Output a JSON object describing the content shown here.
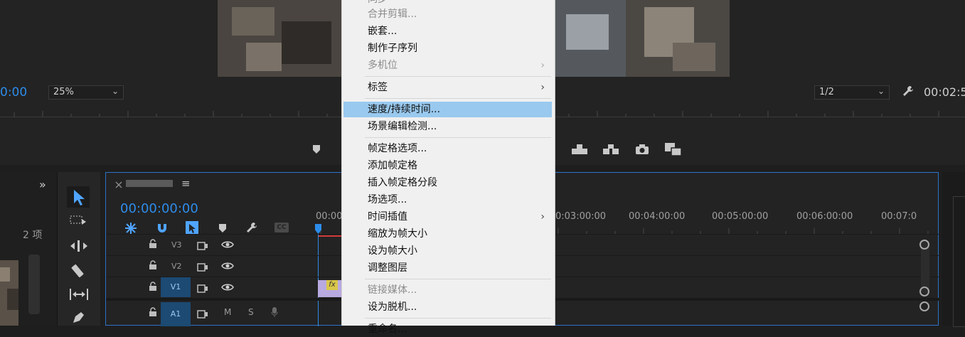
{
  "monitor": {
    "timecode_left": "0:00",
    "zoom_select": "25%",
    "resolution_select": "1/2",
    "timecode_right": "00:02:5"
  },
  "sequence": {
    "name": "",
    "timecode": "00:00:00:00",
    "ruler_labels": [
      "00:00",
      "0:03:00:00",
      "00:04:00:00",
      "00:05:00:00",
      "00:06:00:00",
      "00:07:0"
    ],
    "tracks": {
      "v3": "V3",
      "v2": "V2",
      "v1": "V1",
      "a1": "A1",
      "a1_mute": "M",
      "a1_solo": "S"
    },
    "fx_badge": "fx"
  },
  "project_panel": {
    "item_count": "2 项"
  },
  "context_menu": {
    "items": [
      {
        "label": "同步",
        "disabled": true
      },
      {
        "label": "合并剪辑...",
        "disabled": true
      },
      {
        "label": "嵌套..."
      },
      {
        "label": "制作子序列"
      },
      {
        "label": "多机位",
        "disabled": true,
        "submenu": true
      },
      {
        "label": "标签",
        "submenu": true
      },
      {
        "label": "速度/持续时间...",
        "highlighted": true
      },
      {
        "label": "场景编辑检测..."
      },
      {
        "label": "帧定格选项..."
      },
      {
        "label": "添加帧定格"
      },
      {
        "label": "插入帧定格分段"
      },
      {
        "label": "场选项..."
      },
      {
        "label": "时间插值",
        "submenu": true
      },
      {
        "label": "缩放为帧大小"
      },
      {
        "label": "设为帧大小"
      },
      {
        "label": "调整图层"
      },
      {
        "label": "链接媒体...",
        "disabled": true
      },
      {
        "label": "设为脱机..."
      },
      {
        "label": "重命名..."
      }
    ],
    "submenu_arrow": "›"
  },
  "colors": {
    "accent_blue": "#2d8ceb",
    "menu_highlight": "#99c9ef",
    "track_target": "#1c4a73"
  }
}
